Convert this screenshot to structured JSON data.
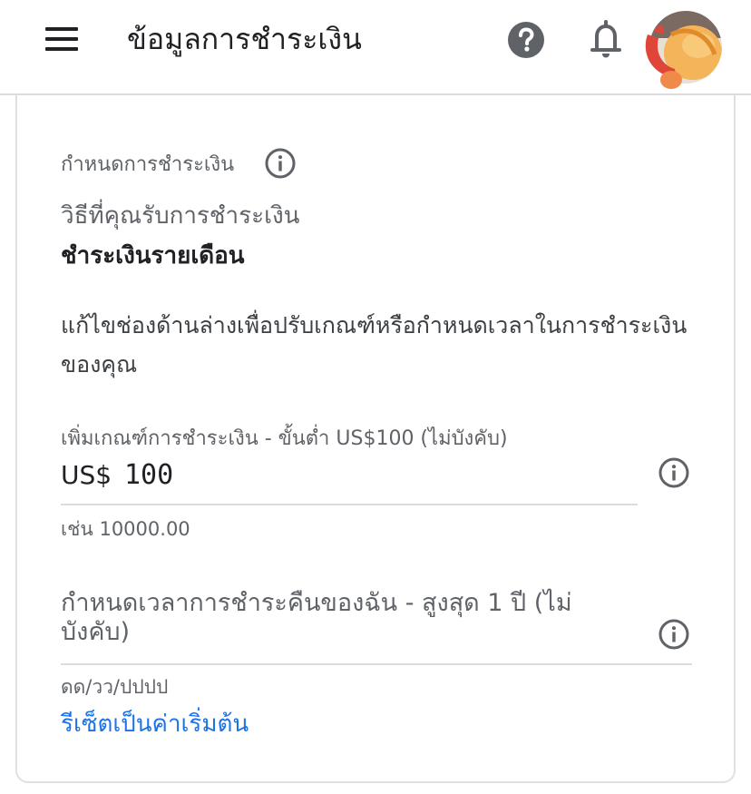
{
  "header": {
    "title": "ข้อมูลการชำระเงิน",
    "icons": [
      "menu-icon",
      "help-icon",
      "bell-icon",
      "avatar"
    ]
  },
  "payment_settings": {
    "section_label": "กำหนดการชำระเงิน",
    "method_label": "วิธีที่คุณรับการชำระเงิน",
    "method_value": "ชำระเงินรายเดือน",
    "description": "แก้ไขช่องด้านล่างเพื่อปรับเกณฑ์หรือกำหนดเวลาในการชำระเงินของคุณ",
    "threshold": {
      "label": "เพิ่มเกณฑ์การชำระเงิน - ขั้นต่ำ US$100 (ไม่บังคับ)",
      "currency": "US$",
      "value": "100",
      "hint": "เช่น 10000.00"
    },
    "hold_date": {
      "label": "กำหนดเวลาการชำระคืนของฉัน - สูงสุด 1 ปี (ไม่บังคับ)",
      "hint": "ดด/วว/ปปปป"
    },
    "reset_label": "รีเซ็ตเป็นค่าเริ่มต้น"
  },
  "colors": {
    "link": "#1a73e8",
    "secondary_text": "#5f6368",
    "icon": "#5f6368",
    "divider": "#dadce0"
  }
}
